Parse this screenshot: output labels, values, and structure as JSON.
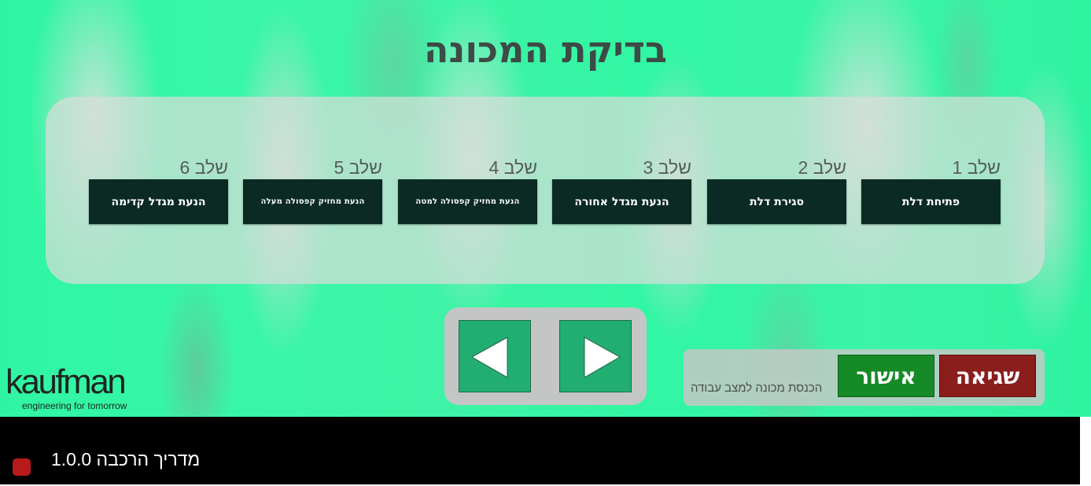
{
  "page": {
    "title": "בדיקת המכונה"
  },
  "steps": [
    {
      "label": "שלב 1",
      "button": "פתיחת דלת"
    },
    {
      "label": "שלב 2",
      "button": "סגירת דלת"
    },
    {
      "label": "שלב 3",
      "button": "הנעת מגדל אחורה"
    },
    {
      "label": "שלב 4",
      "button": "הנעת מחזיק קפסולה למטה"
    },
    {
      "label": "שלב 5",
      "button": "הנעת מחזיק קפסולה מעלה"
    },
    {
      "label": "שלב 6",
      "button": "הנעת מגדל קדימה"
    }
  ],
  "navigation": {
    "prev_icon": "triangle-left-icon",
    "next_icon": "triangle-right-icon"
  },
  "actions": {
    "error_label": "שגיאה",
    "confirm_label": "אישור",
    "caption": "הכנסת מכונה למצב עבודה"
  },
  "logo": {
    "wordmark": "kaufman",
    "tagline": "engineering for tomorrow"
  },
  "footer": {
    "title": "מדריך הרכבה 1.0.0"
  },
  "colors": {
    "background_green": "#31f6a3",
    "step_button": "#0b2a24",
    "nav_button": "#22ae72",
    "error_button": "#8c1d1d",
    "confirm_button": "#168a26",
    "status_indicator": "#b81a1c",
    "footer_background": "#000000"
  }
}
